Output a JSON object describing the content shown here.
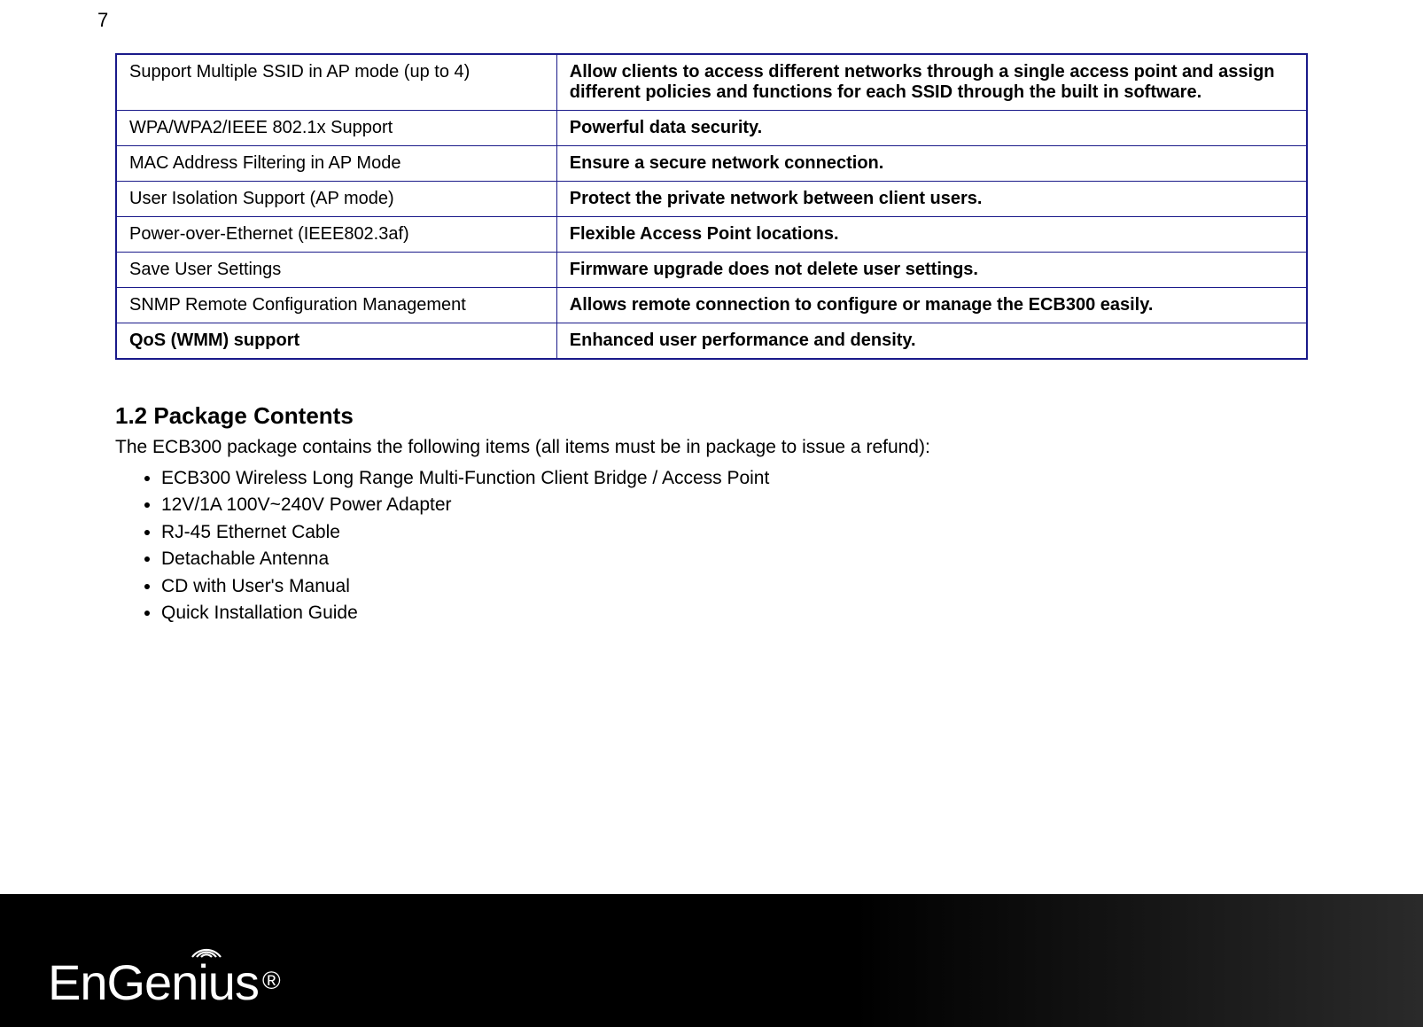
{
  "page_number": "7",
  "table": {
    "rows": [
      {
        "feature": "Support Multiple SSID in AP mode (up to 4)",
        "benefit": "Allow clients to access different networks through a single access point and assign different policies and functions for each SSID through the built in software."
      },
      {
        "feature": "WPA/WPA2/IEEE 802.1x Support",
        "benefit": "Powerful data security."
      },
      {
        "feature": "MAC Address Filtering in AP Mode",
        "benefit": "Ensure a secure network connection."
      },
      {
        "feature": "User Isolation Support (AP mode)",
        "benefit": "Protect the private network between client users."
      },
      {
        "feature": "Power-over-Ethernet (IEEE802.3af)",
        "benefit": "Flexible Access Point locations."
      },
      {
        "feature": "Save User Settings",
        "benefit": "Firmware upgrade does not delete user settings."
      },
      {
        "feature": "SNMP Remote Configuration Management",
        "benefit": "Allows remote connection to configure or manage the ECB300 easily."
      },
      {
        "feature": "QoS (WMM) support",
        "benefit": "Enhanced user performance and density."
      }
    ]
  },
  "section": {
    "heading": "1.2   Package Contents",
    "intro": "The ECB300 package contains the following items (all items must be in package to issue a refund):",
    "items": [
      "ECB300 Wireless Long Range Multi-Function Client Bridge / Access Point",
      "12V/1A 100V~240V Power Adapter",
      "RJ-45 Ethernet Cable",
      "Detachable Antenna",
      "CD with User's Manual",
      "Quick Installation Guide"
    ]
  },
  "logo": {
    "brand_part1": "En",
    "brand_part2": "Gen",
    "brand_part3": "ius",
    "reg": "®"
  }
}
